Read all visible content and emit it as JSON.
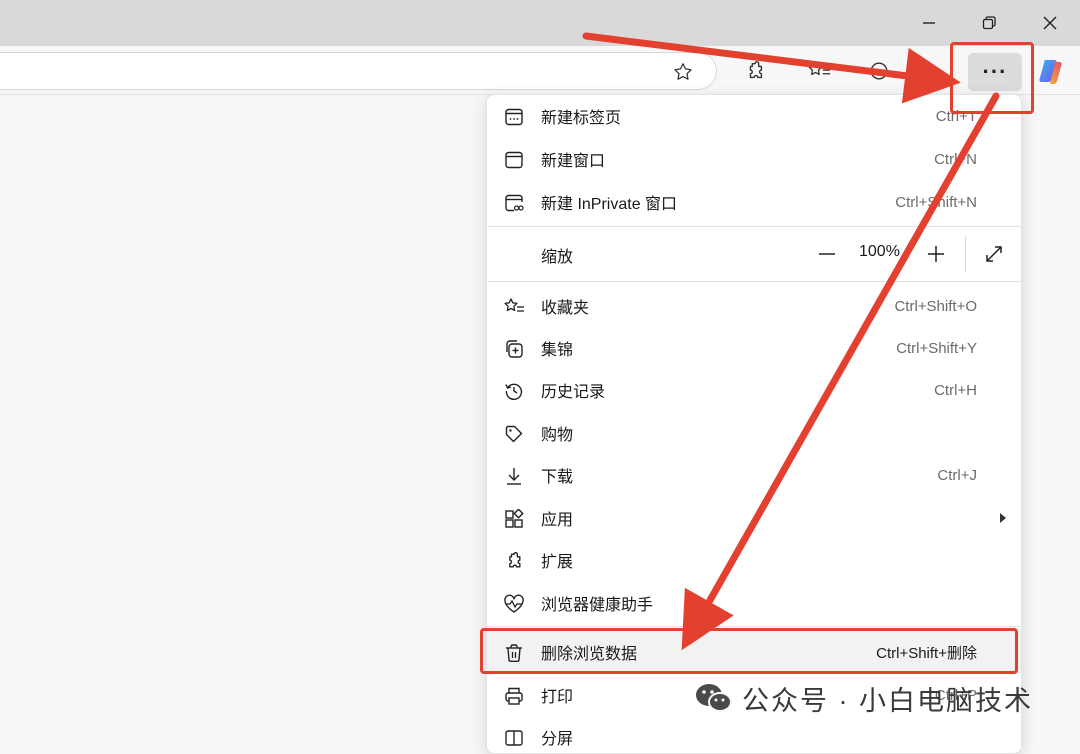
{
  "window": {
    "controls": [
      "minimize-icon",
      "restore-icon",
      "close-icon"
    ]
  },
  "toolbar": {
    "more_label": "···",
    "icons": [
      "star-icon",
      "extensions-icon",
      "favorites-icon",
      "feedback-icon",
      "copilot-icon"
    ]
  },
  "menu": {
    "items": [
      {
        "label": "新建标签页",
        "shortcut": "Ctrl+T",
        "icon": "new-tab-icon"
      },
      {
        "label": "新建窗口",
        "shortcut": "Ctrl+N",
        "icon": "new-window-icon"
      },
      {
        "label": "新建 InPrivate 窗口",
        "shortcut": "Ctrl+Shift+N",
        "icon": "inprivate-icon"
      },
      {
        "label": "收藏夹",
        "shortcut": "Ctrl+Shift+O",
        "icon": "favorites-icon"
      },
      {
        "label": "集锦",
        "shortcut": "Ctrl+Shift+Y",
        "icon": "collections-icon"
      },
      {
        "label": "历史记录",
        "shortcut": "Ctrl+H",
        "icon": "history-icon"
      },
      {
        "label": "购物",
        "shortcut": "",
        "icon": "shopping-tag-icon"
      },
      {
        "label": "下载",
        "shortcut": "Ctrl+J",
        "icon": "download-icon"
      },
      {
        "label": "应用",
        "shortcut": "",
        "icon": "apps-icon"
      },
      {
        "label": "扩展",
        "shortcut": "",
        "icon": "extensions-icon"
      },
      {
        "label": "浏览器健康助手",
        "shortcut": "",
        "icon": "browser-health-icon"
      },
      {
        "label": "删除浏览数据",
        "shortcut": "Ctrl+Shift+删除",
        "icon": "trash-icon"
      },
      {
        "label": "打印",
        "shortcut": "Ctrl+P",
        "icon": "print-icon"
      },
      {
        "label": "分屏",
        "shortcut": "",
        "icon": "split-screen-icon"
      }
    ],
    "zoom": {
      "label": "缩放",
      "value": "100%",
      "minus": "—",
      "plus": "+"
    }
  },
  "watermark": {
    "text": "公众号 · 小白电脑技术"
  },
  "colors": {
    "annotation_red": "#e3402f",
    "menu_bg": "#ffffff",
    "page_bg": "#f7f7f7"
  }
}
